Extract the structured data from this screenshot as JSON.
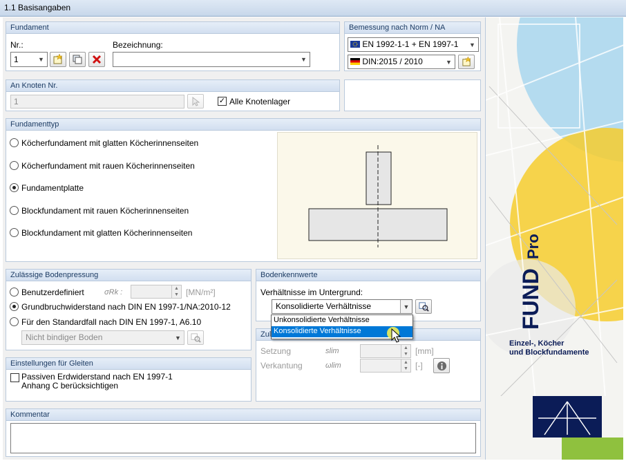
{
  "window": {
    "title": "1.1 Basisangaben"
  },
  "fundament": {
    "header": "Fundament",
    "nr_label": "Nr.:",
    "nr_value": "1",
    "bez_label": "Bezeichnung:",
    "bez_value": ""
  },
  "norm": {
    "header": "Bemessung nach Norm / NA",
    "standard": "EN 1992-1-1 + EN 1997-1",
    "annex": "DIN:2015 / 2010"
  },
  "knoten": {
    "header": "An Knoten Nr.",
    "value": "1",
    "all_label": "Alle Knotenlager",
    "all_checked": "✓"
  },
  "fundamenttyp": {
    "header": "Fundamenttyp",
    "options": [
      "Köcherfundament mit glatten Köcherinnenseiten",
      "Köcherfundament mit rauen Köcherinnenseiten",
      "Fundamentplatte",
      "Blockfundament mit rauen Köcherinnenseiten",
      "Blockfundament mit glatten Köcherinnenseiten"
    ],
    "selected_index": 2
  },
  "bodenpressung": {
    "header": "Zulässige Bodenpressung",
    "opt1": "Benutzerdefiniert",
    "sigma_symbol": "σRk :",
    "unit": "[MN/m²]",
    "opt2": "Grundbruchwiderstand nach DIN EN 1997-1/NA:2010-12",
    "opt3": "Für den Standardfall nach DIN EN 1997-1, A6.10",
    "boden_value": "Nicht bindiger Boden"
  },
  "gleiten": {
    "header": "Einstellungen für Gleiten",
    "line1": "Passiven Erdwiderstand nach EN 1997-1",
    "line2": "Anhang C berücksichtigen"
  },
  "bodenkennwerte": {
    "header": "Bodenkennwerte",
    "label": "Verhältnisse im Untergrund:",
    "value": "Konsolidierte Verhältnisse",
    "options": [
      "Unkonsolidierte Verhältnisse",
      "Konsolidierte Verhältnisse"
    ]
  },
  "zulaessig": {
    "header_left": "Zulä",
    "header_right": "r",
    "setzung_label": "Setzung",
    "setzung_sym": "slim",
    "setzung_unit": "[mm]",
    "verkantung_label": "Verkantung",
    "verkantung_sym": "ωlim",
    "verkantung_unit": "[-]"
  },
  "kommentar": {
    "header": "Kommentar",
    "value": ""
  },
  "brand": {
    "title_main": "FUND",
    "title_pro": "Pro",
    "subtitle_1": "Einzel-, Köcher",
    "subtitle_2": "und Blockfundamente"
  },
  "colors": {
    "accent": "#0b1c57",
    "header_bg": "#d2dff0",
    "selection": "#0078d7"
  }
}
